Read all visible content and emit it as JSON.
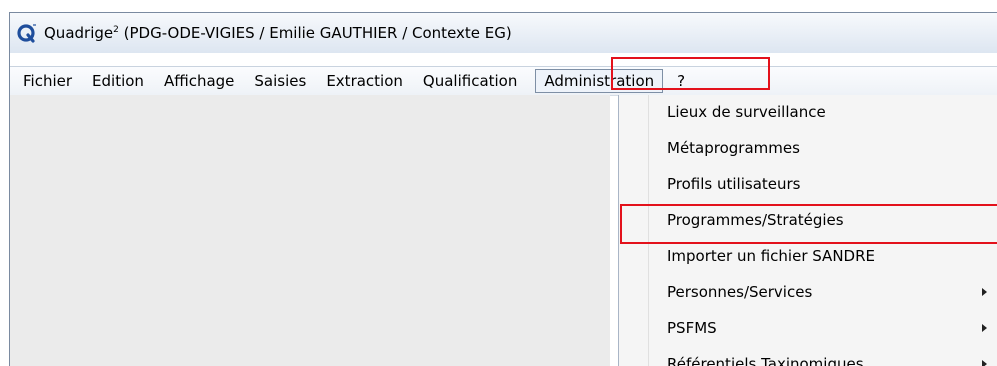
{
  "window": {
    "app_name": "Quadrige",
    "superscript": "2",
    "title_rest": " (PDG-ODE-VIGIES / Emilie GAUTHIER / Contexte EG)",
    "icon": "quadrige-q-icon"
  },
  "menubar": {
    "items": [
      "Fichier",
      "Edition",
      "Affichage",
      "Saisies",
      "Extraction",
      "Qualification",
      "Administration",
      "?"
    ],
    "active": "Administration"
  },
  "dropdown": {
    "items": [
      {
        "label": "Lieux de surveillance",
        "submenu": false
      },
      {
        "label": "Métaprogrammes",
        "submenu": false
      },
      {
        "label": "Profils utilisateurs",
        "submenu": false
      },
      {
        "label": "Programmes/Stratégies",
        "submenu": false,
        "highlighted": true
      },
      {
        "label": "Importer un fichier SANDRE",
        "submenu": false
      },
      {
        "label": "Personnes/Services",
        "submenu": true
      },
      {
        "label": "PSFMS",
        "submenu": true
      },
      {
        "label": "Référentiels Taxinomiques",
        "submenu": true
      }
    ]
  },
  "colors": {
    "highlight_border": "#e3111b",
    "menu_background": "#f5f5f5",
    "client_background": "#ebebeb"
  }
}
